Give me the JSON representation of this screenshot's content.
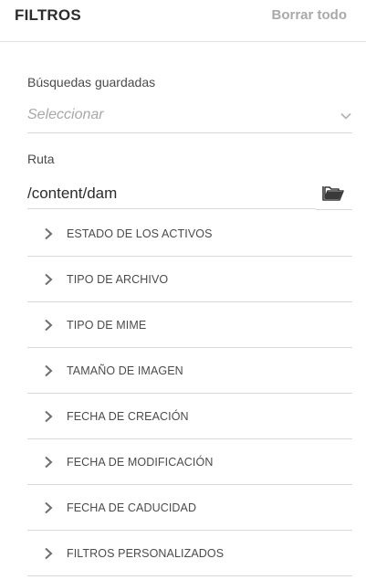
{
  "header": {
    "title": "FILTROS",
    "clear_label": "Borrar todo"
  },
  "saved_searches": {
    "label": "Búsquedas guardadas",
    "placeholder": "Seleccionar",
    "icon": "chevron-down-icon"
  },
  "path": {
    "label": "Ruta",
    "value": "/content/dam",
    "icon": "folder-open-icon"
  },
  "facets": [
    {
      "label": "ESTADO DE LOS ACTIVOS"
    },
    {
      "label": "TIPO DE ARCHIVO"
    },
    {
      "label": "TIPO DE MIME"
    },
    {
      "label": "TAMAÑO DE IMAGEN"
    },
    {
      "label": "FECHA DE CREACIÓN"
    },
    {
      "label": "FECHA DE MODIFICACIÓN"
    },
    {
      "label": "FECHA DE CADUCIDAD"
    },
    {
      "label": "FILTROS PERSONALIZADOS"
    }
  ],
  "colors": {
    "text": "#323232",
    "muted": "#a9a9a9",
    "divider": "#d9d9d9",
    "icon": "#6e6e6e"
  }
}
